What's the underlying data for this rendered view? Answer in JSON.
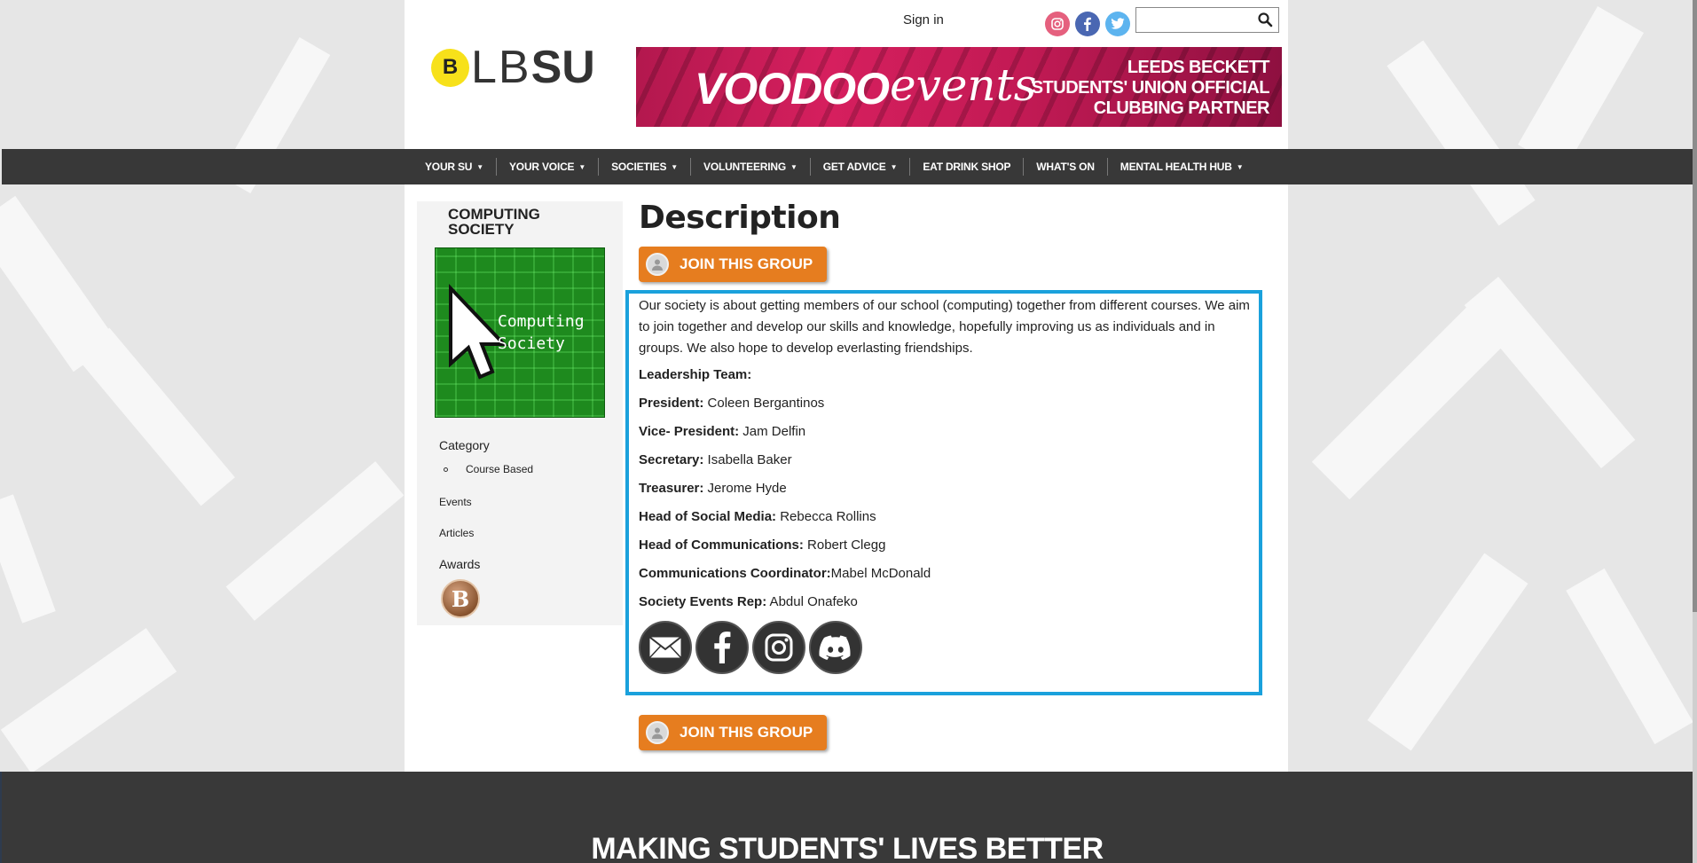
{
  "header": {
    "sign_in": "Sign in",
    "social": [
      "instagram-icon",
      "facebook-icon",
      "twitter-icon"
    ],
    "search_placeholder": ""
  },
  "logo": {
    "mark": "B",
    "text_light": "LB",
    "text_bold": "SU"
  },
  "banner": {
    "brand": "VOODOO",
    "brand_script": "events",
    "tagline": [
      "LEEDS BECKETT",
      "STUDENTS' UNION OFFICIAL",
      "CLUBBING PARTNER"
    ]
  },
  "nav": {
    "items": [
      {
        "label": "YOUR SU",
        "dropdown": true
      },
      {
        "label": "YOUR VOICE",
        "dropdown": true
      },
      {
        "label": "SOCIETIES",
        "dropdown": true
      },
      {
        "label": "VOLUNTEERING",
        "dropdown": true
      },
      {
        "label": "GET ADVICE",
        "dropdown": true
      },
      {
        "label": "EAT DRINK SHOP",
        "dropdown": false
      },
      {
        "label": "WHAT'S ON",
        "dropdown": false
      },
      {
        "label": "MENTAL HEALTH HUB",
        "dropdown": true
      }
    ]
  },
  "sidebar": {
    "group_name_line1": "COMPUTING",
    "group_name_line2": "SOCIETY",
    "image_text_line1": "Computing",
    "image_text_line2": "Society",
    "category_heading": "Category",
    "category_item": "Course Based",
    "events_link": "Events",
    "articles_link": "Articles",
    "awards_heading": "Awards",
    "award_badge": "B"
  },
  "main": {
    "title": "Description",
    "join_label": "JOIN THIS GROUP",
    "description": "Our society is about getting members of our school (computing) together from different courses. We aim to join together and develop our skills and knowledge, hopefully improving us as individuals and in groups. We also hope to develop everlasting friendships.",
    "leadership_heading": "Leadership Team:",
    "roles": [
      {
        "role": "President:",
        "name": " Coleen Bergantinos"
      },
      {
        "role": "Vice- President:",
        "name": " Jam Delfin"
      },
      {
        "role": "Secretary:",
        "name": " Isabella Baker"
      },
      {
        "role": "Treasurer:",
        "name": " Jerome Hyde"
      },
      {
        "role": "Head of Social Media:",
        "name": " Rebecca Rollins"
      },
      {
        "role": "Head of Communications:",
        "name": " Robert Clegg"
      },
      {
        "role": "Communications Coordinator:",
        "name": "Mabel McDonald"
      },
      {
        "role": "Society Events Rep:",
        "name": " Abdul Onafeko"
      }
    ],
    "contact_icons": [
      "email-icon",
      "facebook-icon",
      "instagram-icon",
      "discord-icon"
    ]
  },
  "footer": {
    "title": "MAKING STUDENTS' LIVES BETTER"
  },
  "colors": {
    "accent_blue": "#1aa1dc",
    "join_orange": "#e67d1f",
    "nav_bg": "#383838"
  }
}
